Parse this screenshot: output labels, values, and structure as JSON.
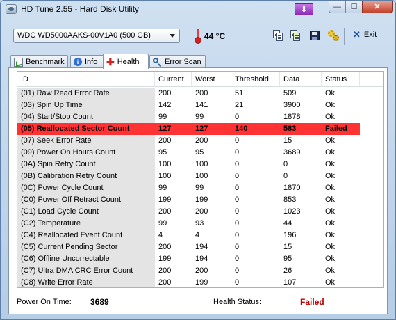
{
  "window": {
    "title": "HD Tune 2.55 - Hard Disk Utility",
    "buttons": {
      "download": "⬇",
      "minimize": "—",
      "maximize": "☐",
      "close": "✕"
    }
  },
  "toolbar": {
    "drive": "WDC WD5000AAKS-00V1A0 (500 GB)",
    "temperature": "44 °C",
    "exit_label": "Exit"
  },
  "tabs": [
    {
      "label": "Benchmark",
      "icon": "benchmark-icon"
    },
    {
      "label": "Info",
      "icon": "info-icon"
    },
    {
      "label": "Health",
      "icon": "health-cross-icon",
      "active": true
    },
    {
      "label": "Error Scan",
      "icon": "search-icon"
    }
  ],
  "table": {
    "columns": [
      "ID",
      "Current",
      "Worst",
      "Threshold",
      "Data",
      "Status"
    ],
    "rows": [
      {
        "id": "(01) Raw Read Error Rate",
        "current": "200",
        "worst": "200",
        "threshold": "51",
        "data": "509",
        "status": "Ok"
      },
      {
        "id": "(03) Spin Up Time",
        "current": "142",
        "worst": "141",
        "threshold": "21",
        "data": "3900",
        "status": "Ok"
      },
      {
        "id": "(04) Start/Stop Count",
        "current": "99",
        "worst": "99",
        "threshold": "0",
        "data": "1878",
        "status": "Ok"
      },
      {
        "id": "(05) Reallocated Sector Count",
        "current": "127",
        "worst": "127",
        "threshold": "140",
        "data": "583",
        "status": "Failed",
        "failed": true
      },
      {
        "id": "(07) Seek Error Rate",
        "current": "200",
        "worst": "200",
        "threshold": "0",
        "data": "15",
        "status": "Ok"
      },
      {
        "id": "(09) Power On Hours Count",
        "current": "95",
        "worst": "95",
        "threshold": "0",
        "data": "3689",
        "status": "Ok"
      },
      {
        "id": "(0A) Spin Retry Count",
        "current": "100",
        "worst": "100",
        "threshold": "0",
        "data": "0",
        "status": "Ok"
      },
      {
        "id": "(0B) Calibration Retry Count",
        "current": "100",
        "worst": "100",
        "threshold": "0",
        "data": "0",
        "status": "Ok"
      },
      {
        "id": "(0C) Power Cycle Count",
        "current": "99",
        "worst": "99",
        "threshold": "0",
        "data": "1870",
        "status": "Ok"
      },
      {
        "id": "(C0) Power Off Retract Count",
        "current": "199",
        "worst": "199",
        "threshold": "0",
        "data": "853",
        "status": "Ok"
      },
      {
        "id": "(C1) Load Cycle Count",
        "current": "200",
        "worst": "200",
        "threshold": "0",
        "data": "1023",
        "status": "Ok"
      },
      {
        "id": "(C2) Temperature",
        "current": "99",
        "worst": "93",
        "threshold": "0",
        "data": "44",
        "status": "Ok"
      },
      {
        "id": "(C4) Reallocated Event Count",
        "current": "4",
        "worst": "4",
        "threshold": "0",
        "data": "196",
        "status": "Ok"
      },
      {
        "id": "(C5) Current Pending Sector",
        "current": "200",
        "worst": "194",
        "threshold": "0",
        "data": "15",
        "status": "Ok"
      },
      {
        "id": "(C6) Offline Uncorrectable",
        "current": "199",
        "worst": "194",
        "threshold": "0",
        "data": "95",
        "status": "Ok"
      },
      {
        "id": "(C7) Ultra DMA CRC Error Count",
        "current": "200",
        "worst": "200",
        "threshold": "0",
        "data": "26",
        "status": "Ok"
      },
      {
        "id": "(C8) Write Error Rate",
        "current": "200",
        "worst": "199",
        "threshold": "0",
        "data": "107",
        "status": "Ok"
      }
    ]
  },
  "footer": {
    "power_on_label": "Power On Time:",
    "power_on_value": "3689",
    "health_label": "Health Status:",
    "health_value": "Failed"
  },
  "colors": {
    "failed_row": "#ff3333",
    "failed_text": "#c00000",
    "id_column_bg": "#e4e4e4",
    "download_button": "#8a2bb8"
  }
}
